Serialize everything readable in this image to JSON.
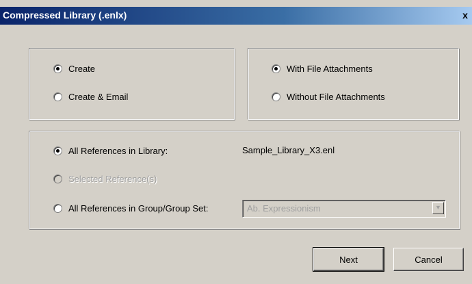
{
  "window": {
    "title": "Compressed Library (.enlx)",
    "close_glyph": "x",
    "colors": {
      "titlebar_start": "#0a246a",
      "titlebar_end": "#a6caf0",
      "face": "#d4d0c8"
    }
  },
  "mode_group": {
    "options": [
      {
        "label": "Create",
        "checked": true
      },
      {
        "label": "Create & Email",
        "checked": false
      }
    ]
  },
  "attachments_group": {
    "options": [
      {
        "label": "With File Attachments",
        "checked": true
      },
      {
        "label": "Without File Attachments",
        "checked": false
      }
    ]
  },
  "references_group": {
    "options": [
      {
        "label": "All References in Library:",
        "checked": true,
        "enabled": true
      },
      {
        "label": "Selected Reference(s)",
        "checked": false,
        "enabled": false
      },
      {
        "label": "All References in Group/Group Set:",
        "checked": false,
        "enabled": true
      }
    ],
    "library_file": "Sample_Library_X3.enl",
    "group_select": {
      "value": "Ab. Expressionism",
      "enabled": false,
      "arrow_icon": "chevron-down-icon"
    }
  },
  "buttons": {
    "next_label": "Next",
    "cancel_label": "Cancel"
  }
}
